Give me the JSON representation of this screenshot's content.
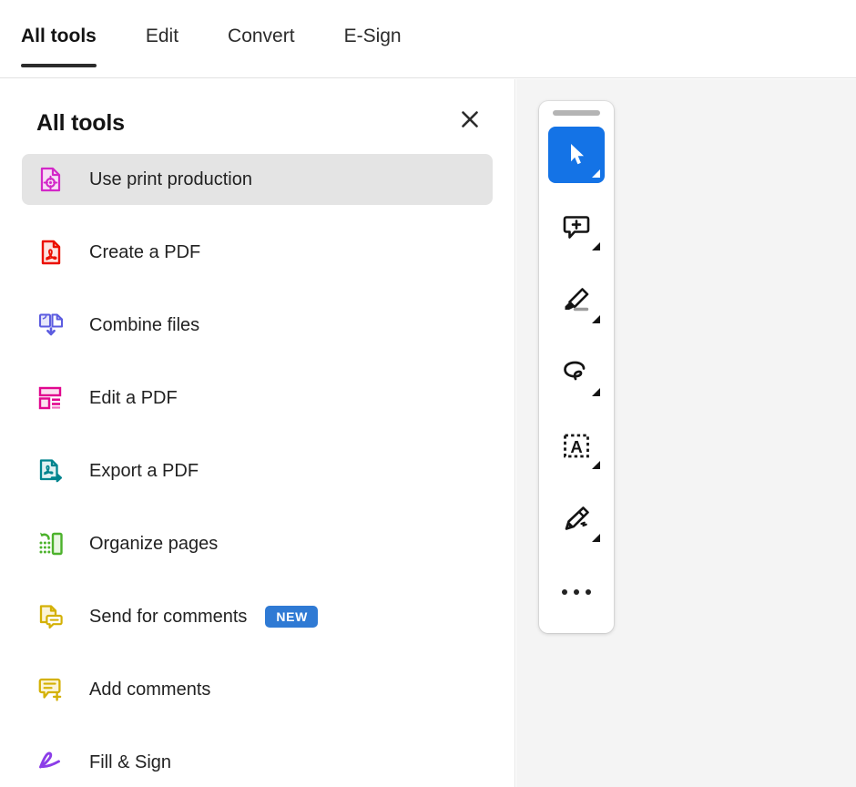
{
  "app": {
    "name": "Adobe Acrobat",
    "accent_blue": "#1473E6",
    "badge_blue": "#2F7AD4",
    "selected_item_bg": "#E4E4E4",
    "doc_area_bg": "#F4F4F4"
  },
  "tabbar": {
    "tabs": [
      {
        "label": "All tools",
        "active": true
      },
      {
        "label": "Edit",
        "active": false
      },
      {
        "label": "Convert",
        "active": false
      },
      {
        "label": "E-Sign",
        "active": false
      }
    ]
  },
  "panel": {
    "title": "All tools",
    "close_icon": "close-icon",
    "items": [
      {
        "label": "Use print production",
        "icon": "print-production-icon",
        "color": "#D328C8",
        "selected": true,
        "badge": null
      },
      {
        "label": "Create a PDF",
        "icon": "create-pdf-icon",
        "color": "#EB1000",
        "selected": false,
        "badge": null
      },
      {
        "label": "Combine files",
        "icon": "combine-files-icon",
        "color": "#5C5CE0",
        "selected": false,
        "badge": null
      },
      {
        "label": "Edit a PDF",
        "icon": "edit-pdf-icon",
        "color": "#E1078F",
        "selected": false,
        "badge": null
      },
      {
        "label": "Export a PDF",
        "icon": "export-pdf-icon",
        "color": "#00848E",
        "selected": false,
        "badge": null
      },
      {
        "label": "Organize pages",
        "icon": "organize-pages-icon",
        "color": "#4CB22C",
        "selected": false,
        "badge": null
      },
      {
        "label": "Send for comments",
        "icon": "send-for-comments-icon",
        "color": "#D4B106",
        "selected": false,
        "badge": "NEW"
      },
      {
        "label": "Add comments",
        "icon": "add-comments-icon",
        "color": "#D4B106",
        "selected": false,
        "badge": null
      },
      {
        "label": "Fill & Sign",
        "icon": "fill-and-sign-icon",
        "color": "#8B3DE8",
        "selected": false,
        "badge": null
      }
    ]
  },
  "floating_toolbar": {
    "handle": "drag-handle",
    "buttons": [
      {
        "name": "select-tool",
        "icon": "cursor-arrow-icon",
        "active": true,
        "has_menu": true
      },
      {
        "name": "add-comment-tool",
        "icon": "comment-plus-icon",
        "active": false,
        "has_menu": true
      },
      {
        "name": "highlight-tool",
        "icon": "highlighter-icon",
        "active": false,
        "has_menu": true
      },
      {
        "name": "draw-tool",
        "icon": "lasso-draw-icon",
        "active": false,
        "has_menu": true
      },
      {
        "name": "text-box-tool",
        "icon": "text-box-a-icon",
        "active": false,
        "has_menu": true
      },
      {
        "name": "signature-tool",
        "icon": "fountain-pen-icon",
        "active": false,
        "has_menu": true
      },
      {
        "name": "more-tools",
        "icon": "ellipsis-icon",
        "active": false,
        "has_menu": false
      }
    ]
  }
}
